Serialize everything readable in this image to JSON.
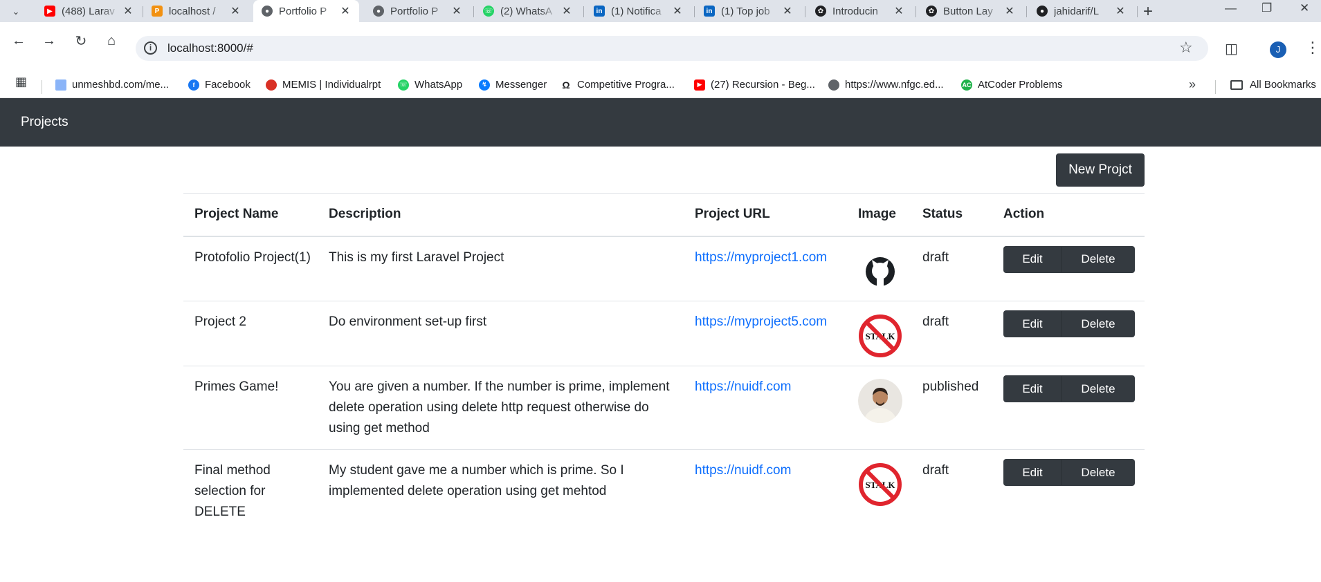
{
  "browser": {
    "tabs": [
      {
        "title": "(488) Larav",
        "icon": "youtube-icon",
        "color": "#ff0000",
        "active": false
      },
      {
        "title": "localhost /",
        "icon": "phpmyadmin-icon",
        "color": "#f29111",
        "active": false
      },
      {
        "title": "Portfolio P",
        "icon": "globe-icon",
        "color": "#5f6368",
        "active": true
      },
      {
        "title": "Portfolio P",
        "icon": "globe-icon",
        "color": "#5f6368",
        "active": false
      },
      {
        "title": "(2) WhatsA",
        "icon": "whatsapp-icon",
        "color": "#25d366",
        "active": false
      },
      {
        "title": "(1) Notifica",
        "icon": "linkedin-icon",
        "color": "#0a66c2",
        "active": false
      },
      {
        "title": "(1) Top job",
        "icon": "linkedin-icon",
        "color": "#0a66c2",
        "active": false
      },
      {
        "title": "Introducin",
        "icon": "openai-icon",
        "color": "#202124",
        "active": false
      },
      {
        "title": "Button Lay",
        "icon": "openai-icon",
        "color": "#202124",
        "active": false
      },
      {
        "title": "jahidarif/L",
        "icon": "github-icon",
        "color": "#202124",
        "active": false
      }
    ],
    "url": "localhost:8000/#",
    "profile_initial": "J",
    "bookmarks": [
      {
        "label": "unmeshbd.com/me...",
        "icon": "document-icon",
        "color": "#8ab4f8"
      },
      {
        "label": "Facebook",
        "icon": "facebook-icon",
        "color": "#1877f2"
      },
      {
        "label": "MEMIS | Individualrpt",
        "icon": "memis-icon",
        "color": "#d93025"
      },
      {
        "label": "WhatsApp",
        "icon": "whatsapp-icon",
        "color": "#25d366"
      },
      {
        "label": "Messenger",
        "icon": "messenger-icon",
        "color": "#0a7cff"
      },
      {
        "label": "Competitive Progra...",
        "icon": "headphones-icon",
        "color": "#202124"
      },
      {
        "label": "(27) Recursion - Beg...",
        "icon": "youtube-icon",
        "color": "#ff0000"
      },
      {
        "label": "https://www.nfgc.ed...",
        "icon": "seal-icon",
        "color": "#5f6368"
      },
      {
        "label": "AtCoder Problems",
        "icon": "atcoder-icon",
        "color": "#21b24b"
      }
    ],
    "all_bookmarks": "All Bookmarks"
  },
  "page": {
    "brand": "Projects",
    "new_button": "New Projct",
    "columns": [
      "Project Name",
      "Description",
      "Project URL",
      "Image",
      "Status",
      "Action"
    ],
    "rows": [
      {
        "name": "Protofolio Project(1)",
        "description": "This is my first Laravel Project",
        "url": "https://myproject1.com",
        "image": "github-logo",
        "status": "draft"
      },
      {
        "name": "Project 2",
        "description": "Do environment set-up first",
        "url": "https://myproject5.com",
        "image": "stalk-sign",
        "status": "draft"
      },
      {
        "name": "Primes Game!",
        "description": "You are given a number. If the number is prime, implement delete operation using delete http request otherwise do using get method",
        "url": "https://nuidf.com",
        "image": "profile-photo",
        "status": "published"
      },
      {
        "name": "Final method selection for DELETE",
        "description": "My student gave me a number which is prime. So I implemented delete operation using get mehtod",
        "url": "https://nuidf.com",
        "image": "stalk-sign",
        "status": "draft"
      }
    ],
    "actions": {
      "edit": "Edit",
      "delete": "Delete"
    },
    "stalk_text": "STALK"
  }
}
